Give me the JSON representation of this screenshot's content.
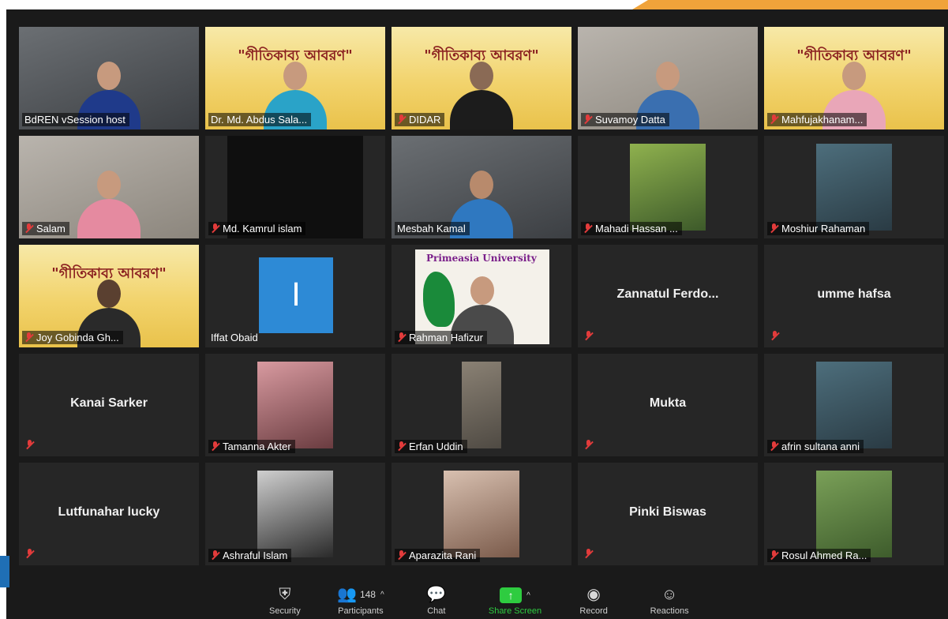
{
  "tiles": [
    {
      "name": "BdREN vSession host",
      "muted": false
    },
    {
      "name": "Dr. Md. Abdus Sala...",
      "muted": false
    },
    {
      "name": "DIDAR",
      "muted": true
    },
    {
      "name": "Suvamoy Datta",
      "muted": true
    },
    {
      "name": "Mahfujakhanam...",
      "muted": true
    },
    {
      "name": "Salam",
      "muted": true
    },
    {
      "name": "Md. Kamrul islam",
      "muted": true
    },
    {
      "name": "Mesbah Kamal",
      "muted": false,
      "active": true
    },
    {
      "name": "Mahadi Hassan ...",
      "muted": true
    },
    {
      "name": "Moshiur Rahaman",
      "muted": true
    },
    {
      "name": "Joy Gobinda Gh...",
      "muted": true
    },
    {
      "name": "Iffat Obaid",
      "muted": false,
      "initial": "I"
    },
    {
      "name": "Rahman Hafizur",
      "muted": true
    },
    {
      "name": "Zannatul  Ferdo...",
      "muted": true
    },
    {
      "name": "umme hafsa",
      "muted": true
    },
    {
      "name": "Kanai Sarker",
      "muted": true
    },
    {
      "name": "Tamanna Akter",
      "muted": true
    },
    {
      "name": "Erfan Uddin",
      "muted": true
    },
    {
      "name": "Mukta",
      "muted": true
    },
    {
      "name": "afrin sultana anni",
      "muted": true
    },
    {
      "name": "Lutfunahar lucky",
      "muted": true
    },
    {
      "name": "Ashraful Islam",
      "muted": true
    },
    {
      "name": "Aparazita Rani",
      "muted": true
    },
    {
      "name": "Pinki Biswas",
      "muted": true
    },
    {
      "name": "Rosul Ahmed Ra...",
      "muted": true
    }
  ],
  "banner": {
    "title": "\"গীতিকাব্য আবরণ\""
  },
  "university": "Primeasia University",
  "toolbar": {
    "security": "Security",
    "participants": "Participants",
    "participants_count": "148",
    "chat": "Chat",
    "share": "Share Screen",
    "record": "Record",
    "reactions": "Reactions"
  },
  "colors": {
    "accent_active": "#e6e06a",
    "share_green": "#2ecc40",
    "mic_red": "#e23b3b",
    "initial_blue": "#2d8ad6"
  }
}
